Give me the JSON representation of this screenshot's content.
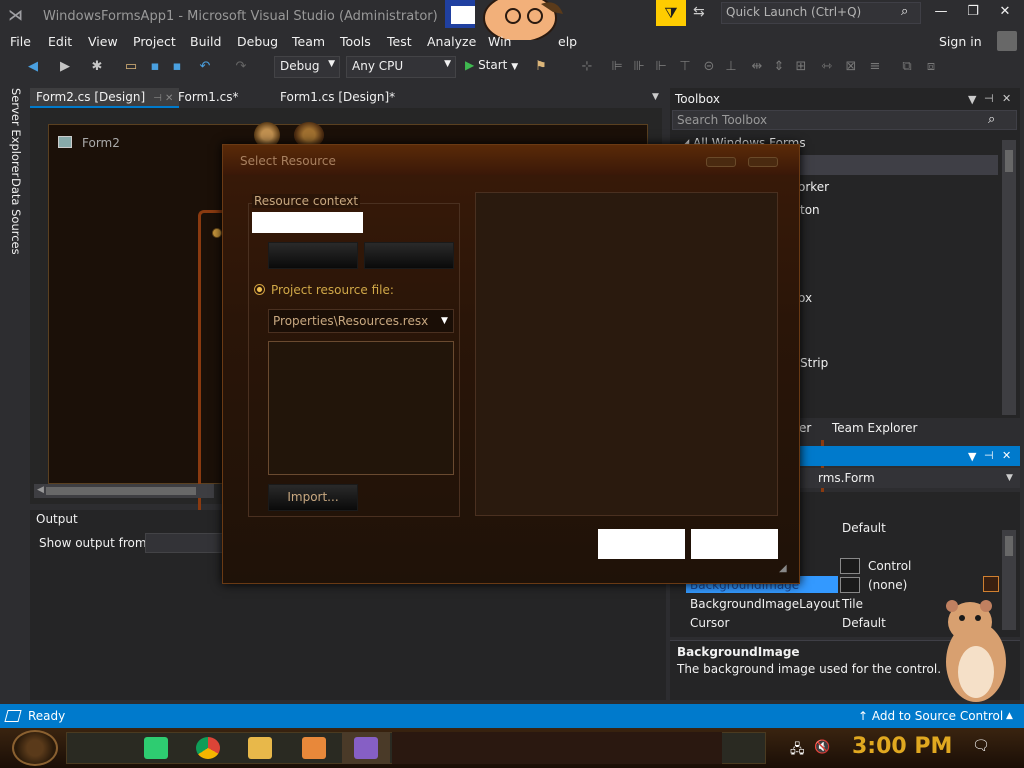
{
  "window": {
    "title": "WindowsFormsApp1 - Microsoft Visual Studio  (Administrator)",
    "quick_launch_placeholder": "Quick Launch (Ctrl+Q)",
    "controls": [
      "—",
      "❐",
      "✕"
    ]
  },
  "menu": {
    "items": [
      "File",
      "Edit",
      "View",
      "Project",
      "Build",
      "Debug",
      "Team",
      "Tools",
      "Test",
      "Analyze",
      "Win",
      "elp"
    ],
    "sign_in": "Sign in"
  },
  "toolbar": {
    "config": "Debug",
    "platform": "Any CPU",
    "start_label": "Start"
  },
  "side_tabs": [
    "Server Explorer",
    "Data Sources"
  ],
  "doc_tabs": [
    {
      "label": "Form2.cs [Design]",
      "active": true
    },
    {
      "label": "Form1.cs*",
      "active": false
    },
    {
      "label": "Form1.cs [Design]*",
      "active": false
    }
  ],
  "designer": {
    "form_title": "Form2"
  },
  "output": {
    "title": "Output",
    "show_from_label": "Show output from:"
  },
  "toolbox": {
    "title": "Toolbox",
    "search_placeholder": "Search Toolbox",
    "group": "All Windows Forms",
    "items_partial": [
      "orker",
      "ton",
      "ox",
      "Strip"
    ]
  },
  "lower_tabs": {
    "explorer_partial": "orer",
    "team_explorer": "Team Explorer"
  },
  "properties": {
    "object": "rms.Form",
    "rows": [
      {
        "name": "",
        "value": "Default"
      },
      {
        "name": "",
        "value": "Control"
      },
      {
        "name": "BackgroundImage",
        "value": "(none)"
      },
      {
        "name": "BackgroundImageLayout",
        "value": "Tile"
      },
      {
        "name": "Cursor",
        "value": "Default"
      }
    ],
    "desc_title": "BackgroundImage",
    "desc_text": "The background image used for the control."
  },
  "dialog": {
    "title": "Select Resource",
    "resource_context": "Resource context",
    "project_resource_file": "Project resource file:",
    "resx_selected": "Properties\\Resources.resx",
    "import_label": "Import..."
  },
  "status": {
    "ready": "Ready",
    "source_control": "Add to Source Control"
  },
  "taskbar": {
    "clock": "3:00 PM"
  },
  "colors": {
    "vs_accent": "#007acc",
    "filter_yellow": "#ffcc00",
    "clock_gold": "#e0a820"
  }
}
